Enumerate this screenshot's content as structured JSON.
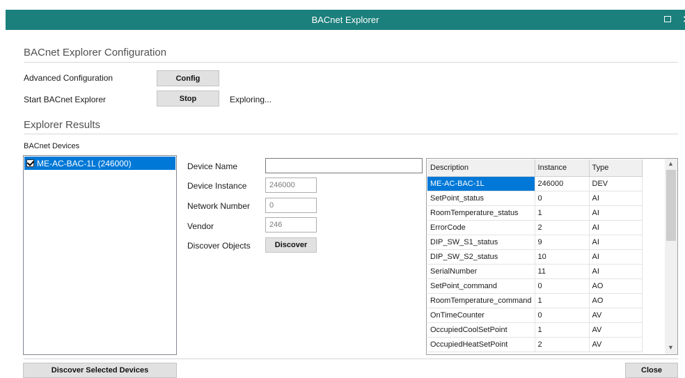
{
  "window": {
    "title": "BACnet Explorer",
    "maximize_icon": "maximize-icon",
    "close_icon": "close-icon",
    "close_glyph": "✕",
    "accent_color": "#1b7f7b"
  },
  "config": {
    "section_title": "BACnet Explorer Configuration",
    "advanced_label": "Advanced Configuration",
    "config_button": "Config",
    "start_label": "Start BACnet Explorer",
    "stop_button": "Stop",
    "status": "Exploring..."
  },
  "results": {
    "section_title": "Explorer Results",
    "devices_label": "BACnet Devices",
    "devices": [
      {
        "label": "ME-AC-BAC-1L (246000)",
        "checked": true,
        "selected": true
      }
    ]
  },
  "device": {
    "name_label": "Device Name",
    "name_value": "",
    "instance_label": "Device Instance",
    "instance_value": "246000",
    "network_label": "Network Number",
    "network_value": "0",
    "vendor_label": "Vendor",
    "vendor_value": "246",
    "discover_label": "Discover Objects",
    "discover_button": "Discover"
  },
  "objects": {
    "columns": [
      "Description",
      "Instance",
      "Type"
    ],
    "rows": [
      [
        "ME-AC-BAC-1L",
        "246000",
        "DEV"
      ],
      [
        "SetPoint_status",
        "0",
        "AI"
      ],
      [
        "RoomTemperature_status",
        "1",
        "AI"
      ],
      [
        "ErrorCode",
        "2",
        "AI"
      ],
      [
        "DIP_SW_S1_status",
        "9",
        "AI"
      ],
      [
        "DIP_SW_S2_status",
        "10",
        "AI"
      ],
      [
        "SerialNumber",
        "11",
        "AI"
      ],
      [
        "SetPoint_command",
        "0",
        "AO"
      ],
      [
        "RoomTemperature_command",
        "1",
        "AO"
      ],
      [
        "OnTimeCounter",
        "0",
        "AV"
      ],
      [
        "OccupiedCoolSetPoint",
        "1",
        "AV"
      ],
      [
        "OccupiedHeatSetPoint",
        "2",
        "AV"
      ]
    ],
    "scroll_up_glyph": "▲",
    "scroll_down_glyph": "▼"
  },
  "footer": {
    "discover_selected_button": "Discover Selected Devices",
    "close_button": "Close"
  }
}
